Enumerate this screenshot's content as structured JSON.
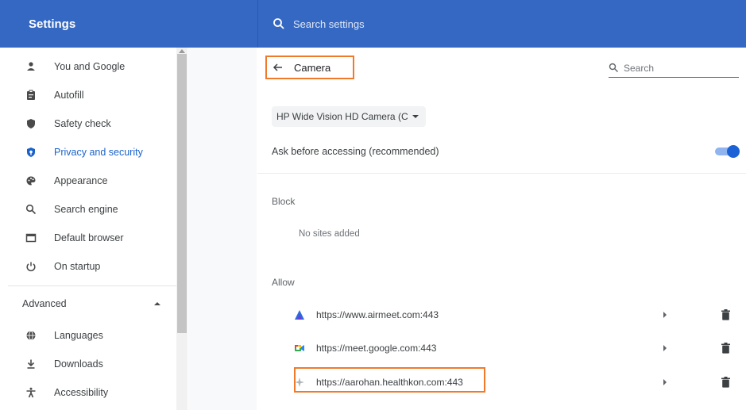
{
  "app": {
    "title": "Settings"
  },
  "top_search": {
    "placeholder": "Search settings"
  },
  "sidebar": {
    "items": [
      {
        "label": "You and Google",
        "icon": "person-icon"
      },
      {
        "label": "Autofill",
        "icon": "clipboard-icon"
      },
      {
        "label": "Safety check",
        "icon": "shield-icon"
      },
      {
        "label": "Privacy and security",
        "icon": "shield-lock-icon",
        "active": true
      },
      {
        "label": "Appearance",
        "icon": "palette-icon"
      },
      {
        "label": "Search engine",
        "icon": "search-icon"
      },
      {
        "label": "Default browser",
        "icon": "browser-window-icon"
      },
      {
        "label": "On startup",
        "icon": "power-icon"
      }
    ],
    "advanced": {
      "label": "Advanced",
      "expanded": true
    },
    "advanced_items": [
      {
        "label": "Languages",
        "icon": "globe-icon"
      },
      {
        "label": "Downloads",
        "icon": "download-icon"
      },
      {
        "label": "Accessibility",
        "icon": "accessibility-icon"
      }
    ]
  },
  "page": {
    "title": "Camera",
    "search_placeholder": "Search",
    "device_select": {
      "value": "HP Wide Vision HD Camera (C"
    },
    "ask_before_accessing": {
      "label": "Ask before accessing (recommended)",
      "enabled": true
    },
    "block": {
      "title": "Block",
      "empty_text": "No sites added"
    },
    "allow": {
      "title": "Allow",
      "sites": [
        {
          "url": "https://www.airmeet.com:443",
          "icon": "airmeet-favicon"
        },
        {
          "url": "https://meet.google.com:443",
          "icon": "google-meet-favicon"
        },
        {
          "url": "https://aarohan.healthkon.com:443",
          "icon": "generic-site-favicon",
          "highlighted": true
        }
      ]
    }
  },
  "colors": {
    "header_blue": "#3568c2",
    "accent_blue": "#1a62c9",
    "highlight_orange": "#f07a2a"
  }
}
